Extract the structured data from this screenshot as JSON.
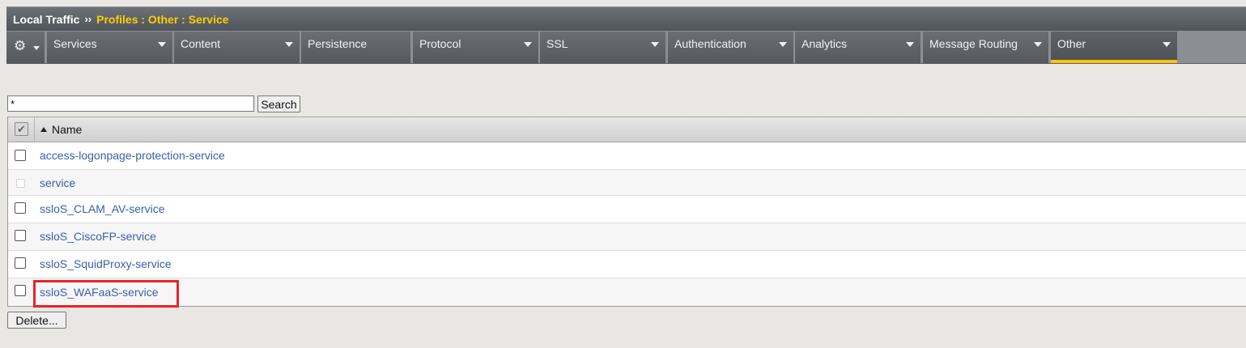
{
  "breadcrumb": {
    "root": "Local Traffic",
    "separator": "››",
    "path": "Profiles : Other : Service"
  },
  "menu": {
    "gear_icon": "gear-icon",
    "items": [
      {
        "label": "Services"
      },
      {
        "label": "Content"
      },
      {
        "label": "Persistence"
      },
      {
        "label": "Protocol"
      },
      {
        "label": "SSL"
      },
      {
        "label": "Authentication"
      },
      {
        "label": "Analytics"
      },
      {
        "label": "Message Routing"
      },
      {
        "label": "Other",
        "active": true
      }
    ],
    "accent_color": "#ffc20e"
  },
  "search": {
    "value": "*",
    "button_label": "Search"
  },
  "table": {
    "header": {
      "name": "Name"
    },
    "rows": [
      {
        "name": "access-logonpage-protection-service",
        "selectable": true
      },
      {
        "name": "service",
        "selectable": false
      },
      {
        "name": "ssloS_CLAM_AV-service",
        "selectable": true
      },
      {
        "name": "ssloS_CiscoFP-service",
        "selectable": true
      },
      {
        "name": "ssloS_SquidProxy-service",
        "selectable": true
      },
      {
        "name": "ssloS_WAFaaS-service",
        "selectable": true,
        "highlighted": true
      }
    ]
  },
  "actions": {
    "delete_label": "Delete..."
  },
  "colors": {
    "link": "#3a5fae",
    "highlight": "#e8232a",
    "breadcrumb_path": "#ffcc00"
  }
}
